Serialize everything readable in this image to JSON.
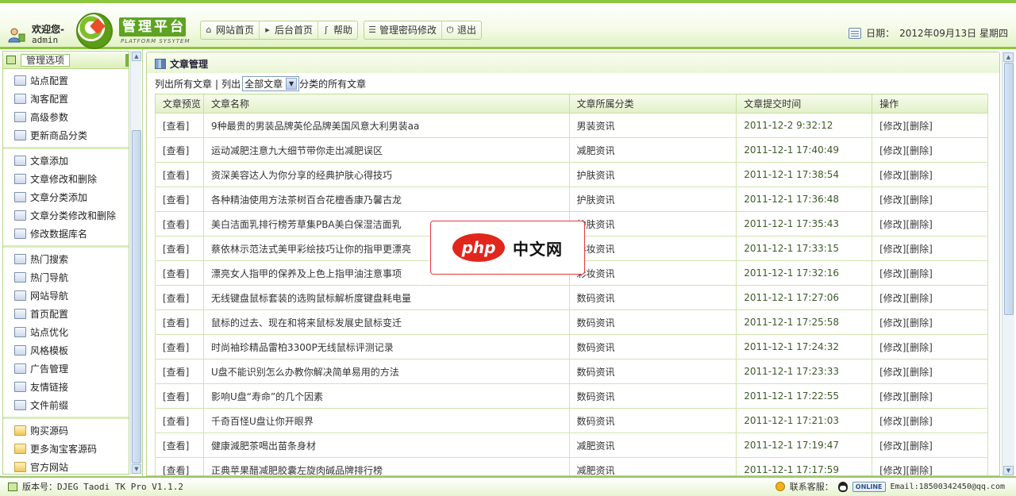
{
  "header": {
    "welcome": "欢迎您-",
    "username": "admin",
    "logo_title": "管理平台",
    "logo_subtitle": "PLATFORM SYSYTEM",
    "nav_group_1": [
      {
        "label": "网站首页",
        "icon": "home-icon"
      },
      {
        "label": "后台首页",
        "icon": "play-icon"
      },
      {
        "label": "帮助",
        "icon": "help-icon"
      }
    ],
    "nav_group_2": [
      {
        "label": "管理密码修改",
        "icon": "list-icon"
      },
      {
        "label": "退出",
        "icon": "power-icon"
      }
    ],
    "date_label": "日期：",
    "date_value": "2012年09月13日 星期四"
  },
  "sidebar": {
    "title": "管理选项",
    "groups": [
      [
        "站点配置",
        "淘客配置",
        "高级参数",
        "更新商品分类"
      ],
      [
        "文章添加",
        "文章修改和删除",
        "文章分类添加",
        "文章分类修改和删除",
        "修改数据库名"
      ],
      [
        "热门搜索",
        "热门导航",
        "网站导航",
        "首页配置",
        "站点优化",
        "风格模板",
        "广告管理",
        "友情链接",
        "文件前缀"
      ],
      [
        "购买源码",
        "更多淘宝客源码",
        "官方网站"
      ]
    ]
  },
  "main": {
    "title": "文章管理",
    "filter_prefix": "列出所有文章",
    "filter_sep": "|",
    "filter_mid": "列出",
    "filter_selected": "全部文章",
    "filter_suffix": "分类的所有文章",
    "columns": [
      "文章预览",
      "文章名称",
      "文章所属分类",
      "文章提交时间",
      "操作"
    ],
    "view_label": "[查看]",
    "edit_label": "[修改]",
    "delete_label": "[删除]",
    "rows": [
      {
        "title": "9种最贵的男装品牌英伦品牌美国风意大利男装aa",
        "category": "男装资讯",
        "time": "2011-12-2 9:32:12"
      },
      {
        "title": "运动减肥注意九大细节带你走出减肥误区",
        "category": "减肥资讯",
        "time": "2011-12-1 17:40:49"
      },
      {
        "title": "资深美容达人为你分享的经典护肤心得技巧",
        "category": "护肤资讯",
        "time": "2011-12-1 17:38:54"
      },
      {
        "title": "各种精油使用方法茶树百合花檀香康乃馨古龙",
        "category": "护肤资讯",
        "time": "2011-12-1 17:36:48"
      },
      {
        "title": "美白洁面乳排行榜芳草集PBA美白保湿洁面乳",
        "category": "护肤资讯",
        "time": "2011-12-1 17:35:43"
      },
      {
        "title": "蔡依林示范法式美甲彩绘技巧让你的指甲更漂亮",
        "category": "彩妆资讯",
        "time": "2011-12-1 17:33:15"
      },
      {
        "title": "漂亮女人指甲的保养及上色上指甲油注意事项",
        "category": "彩妆资讯",
        "time": "2011-12-1 17:32:16"
      },
      {
        "title": "无线键盘鼠标套装的选购鼠标解析度键盘耗电量",
        "category": "数码资讯",
        "time": "2011-12-1 17:27:06"
      },
      {
        "title": "鼠标的过去、现在和将来鼠标发展史鼠标变迁",
        "category": "数码资讯",
        "time": "2011-12-1 17:25:58"
      },
      {
        "title": "时尚袖珍精品雷柏3300P无线鼠标评测记录",
        "category": "数码资讯",
        "time": "2011-12-1 17:24:32"
      },
      {
        "title": "U盘不能识别怎么办教你解决简单易用的方法",
        "category": "数码资讯",
        "time": "2011-12-1 17:23:33"
      },
      {
        "title": "影响U盘“寿命”的几个因素",
        "category": "数码资讯",
        "time": "2011-12-1 17:22:55"
      },
      {
        "title": "千奇百怪U盘让你开眼界",
        "category": "数码资讯",
        "time": "2011-12-1 17:21:03"
      },
      {
        "title": "健康減肥茶喝出苗条身材",
        "category": "减肥资讯",
        "time": "2011-12-1 17:19:47"
      },
      {
        "title": "正典苹果醋减肥胶囊左旋肉碱品牌排行榜",
        "category": "减肥资讯",
        "time": "2011-12-1 17:17:59"
      }
    ]
  },
  "footer": {
    "version": "版本号：DJEG Taodi TK Pro V1.1.2",
    "support_label": "联系客服：",
    "online": "ONLINE",
    "email": "Email:18500342450@qq.com"
  },
  "watermark": {
    "php": "php",
    "cn": "中文网"
  }
}
